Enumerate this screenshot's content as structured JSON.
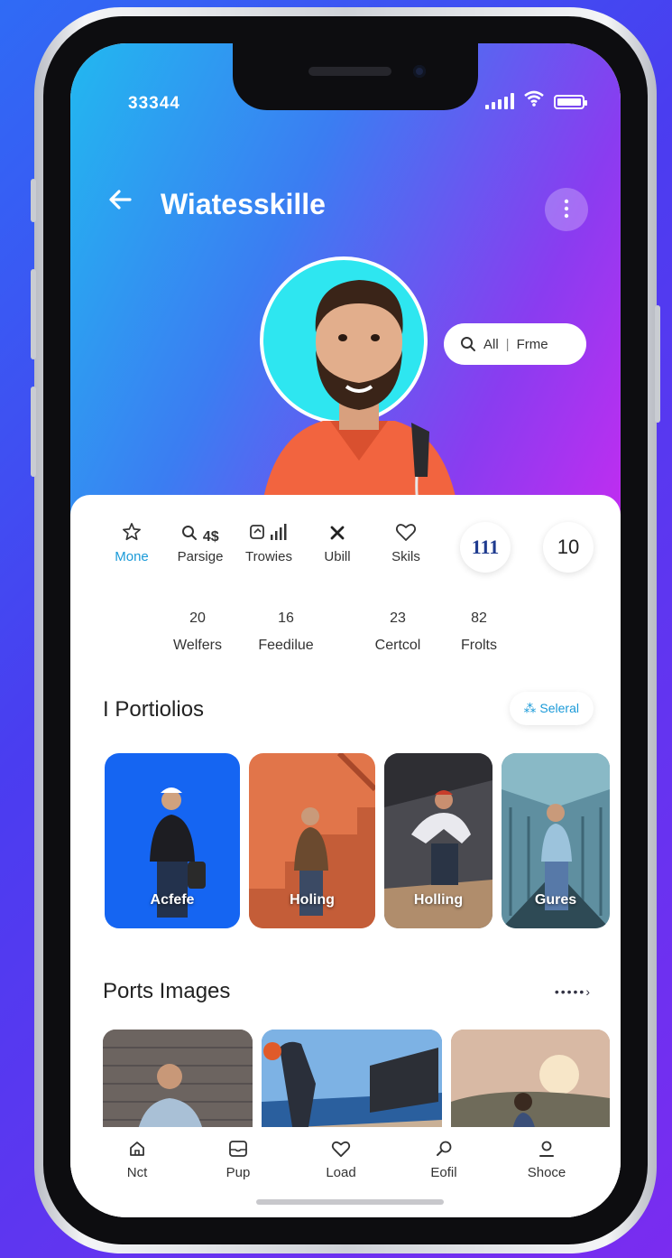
{
  "status_bar": {
    "time": "33344"
  },
  "header": {
    "title": "Wiatesskille",
    "back_icon": "arrow-left-icon",
    "more_icon": "more-vertical-icon"
  },
  "search_chip": {
    "label": "All",
    "divider": "|",
    "value": "Frme"
  },
  "tabs": [
    {
      "label": "Mone",
      "icon": "star-icon",
      "active": true
    },
    {
      "label": "Parsige",
      "icon": "search-icon",
      "badge": "4$",
      "active": false
    },
    {
      "label": "Trowies",
      "icon": "chart-icon",
      "active": false
    },
    {
      "label": "Ubill",
      "icon": "close-icon",
      "active": false
    },
    {
      "label": "Skils",
      "icon": "heart-icon",
      "active": false
    }
  ],
  "round_stats": [
    {
      "value": "111"
    },
    {
      "value": "10"
    }
  ],
  "stats": [
    {
      "value": "20",
      "label": "Welfers"
    },
    {
      "value": "16",
      "label": "Feedilue"
    },
    {
      "value": "23",
      "label": "Certcol"
    },
    {
      "value": "82",
      "label": "Frolts"
    }
  ],
  "portfolios": {
    "title": "I Portiolios",
    "action_label": "Seleral",
    "tiles": [
      {
        "label": "Acfefe",
        "bg": "#1565f2"
      },
      {
        "label": "Holing",
        "bg": "#e1754a"
      },
      {
        "label": "Holling",
        "bg": "#4a4a50"
      },
      {
        "label": "Gures",
        "bg": "#5f8fa0"
      }
    ]
  },
  "ports_images": {
    "title": "Ports Images",
    "dots": "•••••›"
  },
  "bottom_nav": [
    {
      "label": "Nct",
      "icon": "home-icon"
    },
    {
      "label": "Pup",
      "icon": "inbox-icon"
    },
    {
      "label": "Load",
      "icon": "heart-icon"
    },
    {
      "label": "Eofil",
      "icon": "search-icon"
    },
    {
      "label": "Shoce",
      "icon": "profile-icon"
    }
  ],
  "colors": {
    "accent": "#1a9ad8",
    "brand_gradient_start": "#22b8f0",
    "brand_gradient_end": "#c42cf0"
  }
}
